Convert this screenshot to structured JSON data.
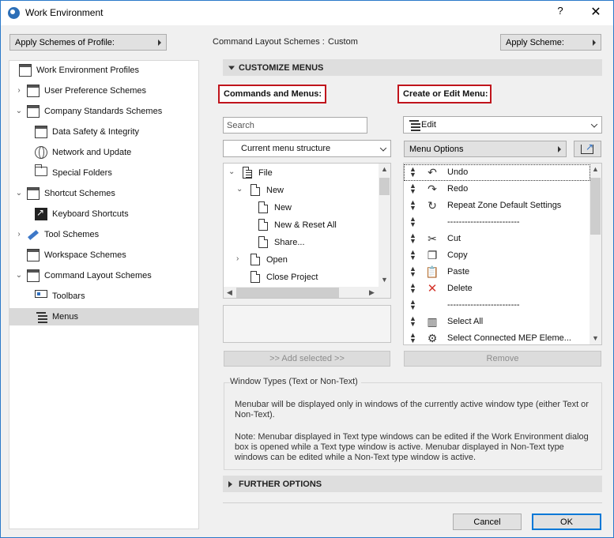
{
  "window": {
    "title": "Work Environment",
    "help_label": "?",
    "close_label": "✕"
  },
  "top": {
    "apply_profile_label": "Apply Schemes of Profile:",
    "layout_label": "Command Layout Schemes :",
    "layout_value": "Custom",
    "apply_scheme_label": "Apply Scheme:"
  },
  "tree": {
    "items": [
      {
        "label": "Work Environment Profiles",
        "icon": "window-icon",
        "chevron": ""
      },
      {
        "label": "User Preference Schemes",
        "icon": "window-icon",
        "chevron": "›"
      },
      {
        "label": "Company Standards Schemes",
        "icon": "window-icon",
        "chevron": "⌄"
      },
      {
        "label": "Data Safety & Integrity",
        "icon": "window-icon",
        "chevron": ""
      },
      {
        "label": "Network and Update",
        "icon": "globe-icon",
        "chevron": ""
      },
      {
        "label": "Special Folders",
        "icon": "folder-icon",
        "chevron": ""
      },
      {
        "label": "Shortcut Schemes",
        "icon": "window-icon",
        "chevron": "⌄"
      },
      {
        "label": "Keyboard Shortcuts",
        "icon": "shortcut-icon",
        "chevron": ""
      },
      {
        "label": "Tool Schemes",
        "icon": "tool-icon",
        "chevron": "›"
      },
      {
        "label": "Workspace Schemes",
        "icon": "window-icon",
        "chevron": ""
      },
      {
        "label": "Command Layout Schemes",
        "icon": "window-icon",
        "chevron": "⌄"
      },
      {
        "label": "Toolbars",
        "icon": "toolbar-icon",
        "chevron": ""
      },
      {
        "label": "Menus",
        "icon": "menus-icon",
        "chevron": ""
      }
    ]
  },
  "customize": {
    "header": "CUSTOMIZE MENUS",
    "commands_title": "Commands and Menus:",
    "edit_title": "Create or Edit Menu:",
    "search_placeholder": "Search",
    "structure_select": "Current menu structure",
    "edit_select": "Edit",
    "menu_options_label": "Menu Options",
    "add_selected_label": ">> Add selected >>",
    "remove_label": "Remove",
    "commands": [
      {
        "label": "File",
        "chevron": "⌄"
      },
      {
        "label": "New",
        "chevron": "⌄"
      },
      {
        "label": "New",
        "chevron": ""
      },
      {
        "label": "New & Reset All",
        "chevron": ""
      },
      {
        "label": "Share...",
        "chevron": ""
      },
      {
        "label": "Open",
        "chevron": "›"
      },
      {
        "label": "Close Project",
        "chevron": ""
      }
    ],
    "menu_items": [
      {
        "label": "Undo",
        "icon": "↶"
      },
      {
        "label": "Redo",
        "icon": "↷"
      },
      {
        "label": "Repeat Zone Default Settings",
        "icon": "↻"
      },
      {
        "label": "-------------------------",
        "icon": ""
      },
      {
        "label": "Cut",
        "icon": "✂"
      },
      {
        "label": "Copy",
        "icon": "❐"
      },
      {
        "label": "Paste",
        "icon": "📋"
      },
      {
        "label": "Delete",
        "icon": "✕"
      },
      {
        "label": "-------------------------",
        "icon": ""
      },
      {
        "label": "Select All",
        "icon": "▥"
      },
      {
        "label": "Select Connected MEP Eleme...",
        "icon": "⚙"
      }
    ]
  },
  "window_types": {
    "title": "Window Types (Text or Non-Text)",
    "para1": "Menubar will be displayed only in windows of the currently active window type (either Text or Non-Text).",
    "para2": "Note: Menubar displayed in Text type windows can be edited if the Work Environment dialog box is opened while a Text type window is active. Menubar displayed in Non-Text type windows can be edited while a Non-Text type window is active."
  },
  "further_options": {
    "header": "FURTHER OPTIONS"
  },
  "footer": {
    "cancel_label": "Cancel",
    "ok_label": "OK"
  },
  "colors": {
    "accent": "#0078d7",
    "highlight_box": "#c0141c",
    "selected_row": "#d9d9d9"
  }
}
